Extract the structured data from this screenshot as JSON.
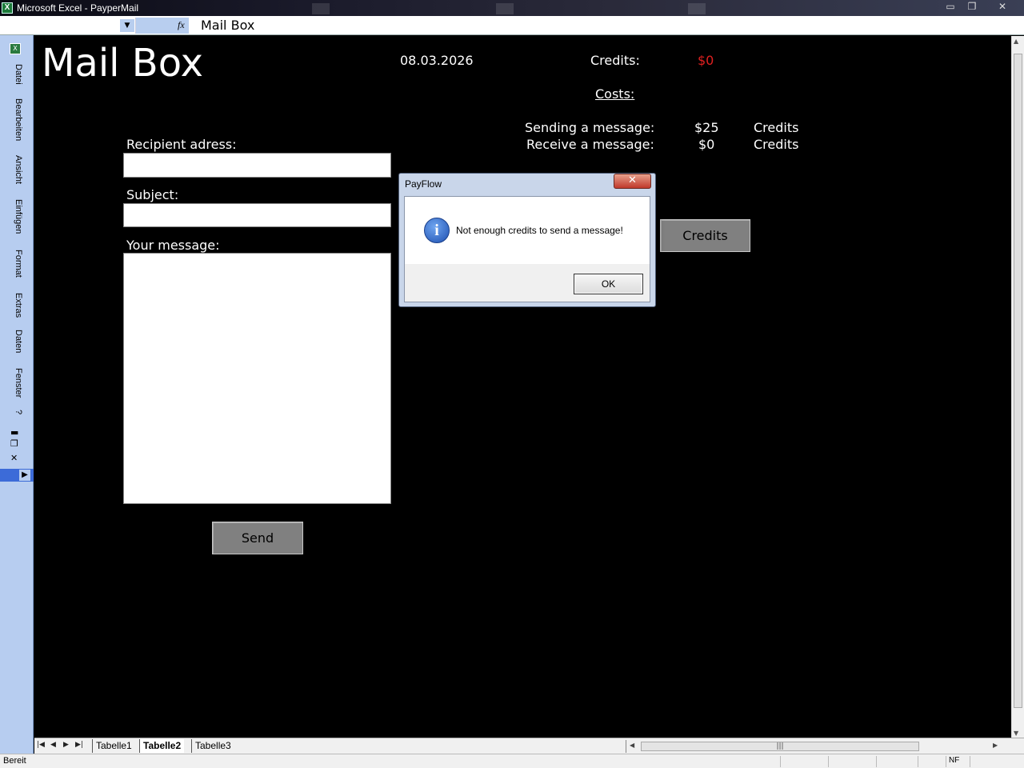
{
  "window": {
    "title": "Microsoft Excel - PayperMail",
    "app_icon": "excel-icon",
    "minimize": "▭",
    "restore": "❐",
    "close": "✕"
  },
  "formula_bar": {
    "name_box": "",
    "fx": "fx",
    "value": "Mail Box"
  },
  "left_menu": {
    "items": [
      "Datei",
      "Bearbeiten",
      "Ansicht",
      "Einfügen",
      "Format",
      "Extras",
      "Daten",
      "Fenster",
      "?"
    ]
  },
  "sheet": {
    "title": "Mail Box",
    "date": "08.03.2026",
    "credits_label": "Credits:",
    "credits_value": "$0",
    "costs_label": "Costs:",
    "cost_rows": [
      {
        "label": "Sending a message:",
        "amount": "$25",
        "unit": "Credits"
      },
      {
        "label": "Receive a message:",
        "amount": "$0",
        "unit": "Credits"
      }
    ],
    "recipient_label": "Recipient adress:",
    "recipient_value": "",
    "subject_label": "Subject:",
    "subject_value": "",
    "message_label": "Your message:",
    "message_value": "",
    "send_button": "Send",
    "credits_button": "Credits"
  },
  "tabs": [
    "Tabelle1",
    "Tabelle2",
    "Tabelle3"
  ],
  "active_tab": "Tabelle2",
  "status": {
    "text": "Bereit",
    "nf": "NF"
  },
  "dialog": {
    "title": "PayFlow",
    "close": "✕",
    "icon": "info-icon",
    "message": "Not enough credits to send a message!",
    "ok_label": "OK"
  },
  "colors": {
    "credits_value": "#e02020",
    "sheet_background": "#000000",
    "menu_background": "#b7cdf0"
  }
}
